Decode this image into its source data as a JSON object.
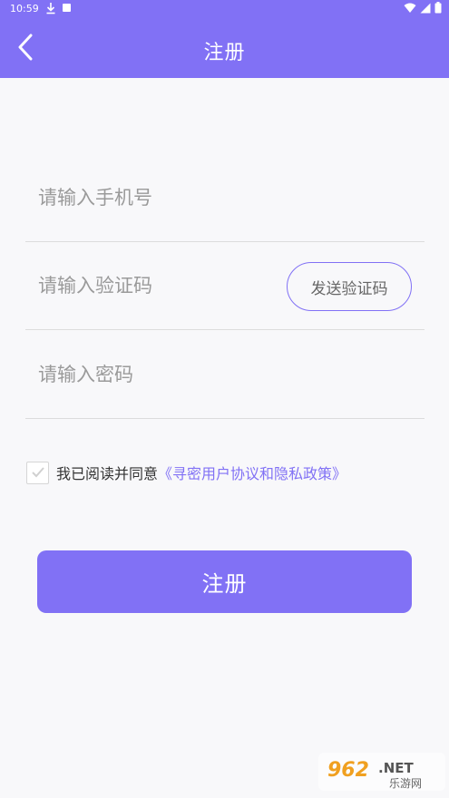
{
  "status_bar": {
    "time": "10:59"
  },
  "nav": {
    "title": "注册"
  },
  "form": {
    "phone": {
      "placeholder": "请输入手机号",
      "value": ""
    },
    "code": {
      "placeholder": "请输入验证码",
      "value": ""
    },
    "send_code_label": "发送验证码",
    "password": {
      "placeholder": "请输入密码",
      "value": ""
    }
  },
  "agreement": {
    "checked": false,
    "text": "我已阅读并同意",
    "link_text": "《寻密用户协议和隐私政策》"
  },
  "submit_label": "注册",
  "watermark": {
    "brand": "962",
    "suffix": ".NET",
    "subtitle": "乐游网"
  },
  "colors": {
    "accent": "#8171f5",
    "background": "#f8f8fa"
  }
}
